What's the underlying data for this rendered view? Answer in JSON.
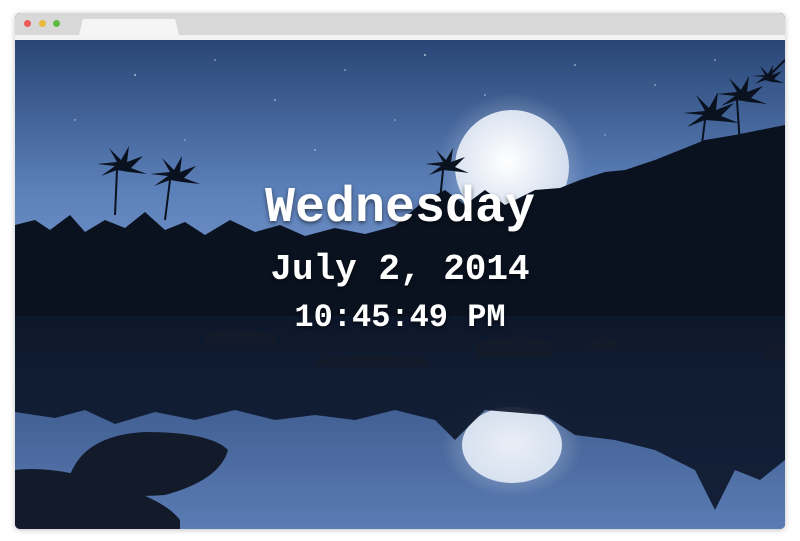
{
  "window": {
    "controls": [
      "close",
      "minimize",
      "maximize"
    ],
    "tab_label": ""
  },
  "background": {
    "description_icon": "night-moon-lake-palms-image",
    "sky_top": "#2d4a7c",
    "sky_bottom": "#6f8fc2",
    "moon": "#eef2f8",
    "silhouette": "#0a1220"
  },
  "clock": {
    "day": "Wednesday",
    "date": "July 2, 2014",
    "time": "10:45:49 PM"
  }
}
